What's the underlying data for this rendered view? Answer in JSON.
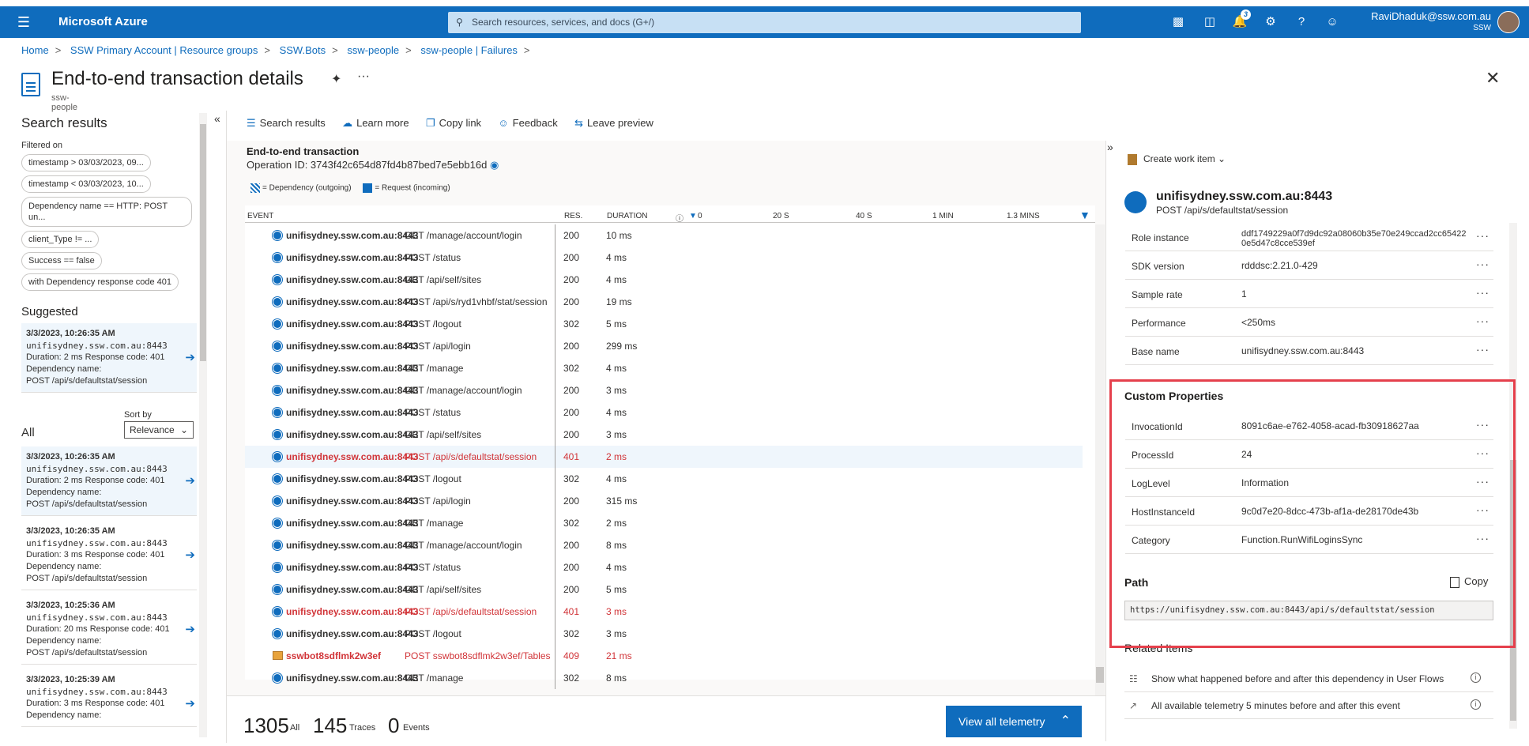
{
  "app": {
    "brand": "Microsoft Azure",
    "search_placeholder": "Search resources, services, and docs (G+/)",
    "notif_count": "3",
    "user": "RaviDhaduk@ssw.com.au",
    "org": "SSW"
  },
  "breadcrumb": [
    "Home",
    "SSW Primary Account | Resource groups",
    "SSW.Bots",
    "ssw-people",
    "ssw-people | Failures"
  ],
  "page": {
    "title": "End-to-end transaction details",
    "subtitle": "ssw-people"
  },
  "toolbar": {
    "search_results": "Search results",
    "learn_more": "Learn more",
    "copy_link": "Copy link",
    "feedback": "Feedback",
    "leave_preview": "Leave preview"
  },
  "left": {
    "title": "Search results",
    "filtered_on": "Filtered on",
    "chips": [
      "timestamp > 03/03/2023, 09...",
      "timestamp < 03/03/2023, 10...",
      "Dependency name == HTTP: POST un...",
      "client_Type != ...",
      "Success == false",
      "with Dependency response code 401"
    ],
    "suggested": "Suggested",
    "all": "All",
    "sort_by": "Sort by",
    "sort_value": "Relevance",
    "suggested_items": [
      {
        "time": "3/3/2023, 10:26:35 AM",
        "host": "unifisydney.ssw.com.au:8443",
        "meta": "Duration: 2 ms  Response code: 401",
        "dep_label": "Dependency name:",
        "dep": "POST /api/s/defaultstat/session"
      }
    ],
    "all_items": [
      {
        "time": "3/3/2023, 10:26:35 AM",
        "host": "unifisydney.ssw.com.au:8443",
        "meta": "Duration: 2 ms  Response code: 401",
        "dep_label": "Dependency name:",
        "dep": "POST /api/s/defaultstat/session"
      },
      {
        "time": "3/3/2023, 10:26:35 AM",
        "host": "unifisydney.ssw.com.au:8443",
        "meta": "Duration: 3 ms  Response code: 401",
        "dep_label": "Dependency name:",
        "dep": "POST /api/s/defaultstat/session"
      },
      {
        "time": "3/3/2023, 10:25:36 AM",
        "host": "unifisydney.ssw.com.au:8443",
        "meta": "Duration: 20 ms  Response code: 401",
        "dep_label": "Dependency name:",
        "dep": "POST /api/s/defaultstat/session"
      },
      {
        "time": "3/3/2023, 10:25:39 AM",
        "host": "unifisydney.ssw.com.au:8443",
        "meta": "Duration: 3 ms  Response code: 401",
        "dep_label": "Dependency name:",
        "dep": ""
      }
    ]
  },
  "transaction": {
    "title": "End-to-end transaction",
    "op_id": "Operation ID: 3743f42c654d87fd4b87bed7e5ebb16d",
    "legend_dep": "= Dependency (outgoing)",
    "legend_req": "= Request (incoming)",
    "headers": {
      "event": "EVENT",
      "res": "RES.",
      "duration": "DURATION"
    },
    "timeline": [
      "0",
      "20 S",
      "40 S",
      "1 MIN",
      "1.3 MINS"
    ],
    "rows": [
      {
        "host": "unifisydney.ssw.com.au:8443",
        "op": "GET /manage/account/login",
        "code": "200",
        "dur": "10 ms",
        "err": false,
        "icon": "globe"
      },
      {
        "host": "unifisydney.ssw.com.au:8443",
        "op": "POST /status",
        "code": "200",
        "dur": "4 ms",
        "err": false,
        "icon": "globe"
      },
      {
        "host": "unifisydney.ssw.com.au:8443",
        "op": "GET /api/self/sites",
        "code": "200",
        "dur": "4 ms",
        "err": false,
        "icon": "globe"
      },
      {
        "host": "unifisydney.ssw.com.au:8443",
        "op": "POST /api/s/ryd1vhbf/stat/session",
        "code": "200",
        "dur": "19 ms",
        "err": false,
        "icon": "globe"
      },
      {
        "host": "unifisydney.ssw.com.au:8443",
        "op": "POST /logout",
        "code": "302",
        "dur": "5 ms",
        "err": false,
        "icon": "globe"
      },
      {
        "host": "unifisydney.ssw.com.au:8443",
        "op": "POST /api/login",
        "code": "200",
        "dur": "299 ms",
        "err": false,
        "icon": "globe"
      },
      {
        "host": "unifisydney.ssw.com.au:8443",
        "op": "GET /manage",
        "code": "302",
        "dur": "4 ms",
        "err": false,
        "icon": "globe"
      },
      {
        "host": "unifisydney.ssw.com.au:8443",
        "op": "GET /manage/account/login",
        "code": "200",
        "dur": "3 ms",
        "err": false,
        "icon": "globe"
      },
      {
        "host": "unifisydney.ssw.com.au:8443",
        "op": "POST /status",
        "code": "200",
        "dur": "4 ms",
        "err": false,
        "icon": "globe"
      },
      {
        "host": "unifisydney.ssw.com.au:8443",
        "op": "GET /api/self/sites",
        "code": "200",
        "dur": "3 ms",
        "err": false,
        "icon": "globe"
      },
      {
        "host": "unifisydney.ssw.com.au:8443",
        "op": "POST /api/s/defaultstat/session",
        "code": "401",
        "dur": "2 ms",
        "err": true,
        "hl": true,
        "icon": "globe"
      },
      {
        "host": "unifisydney.ssw.com.au:8443",
        "op": "POST /logout",
        "code": "302",
        "dur": "4 ms",
        "err": false,
        "icon": "globe"
      },
      {
        "host": "unifisydney.ssw.com.au:8443",
        "op": "POST /api/login",
        "code": "200",
        "dur": "315 ms",
        "err": false,
        "icon": "globe"
      },
      {
        "host": "unifisydney.ssw.com.au:8443",
        "op": "GET /manage",
        "code": "302",
        "dur": "2 ms",
        "err": false,
        "icon": "globe"
      },
      {
        "host": "unifisydney.ssw.com.au:8443",
        "op": "GET /manage/account/login",
        "code": "200",
        "dur": "8 ms",
        "err": false,
        "icon": "globe"
      },
      {
        "host": "unifisydney.ssw.com.au:8443",
        "op": "POST /status",
        "code": "200",
        "dur": "4 ms",
        "err": false,
        "icon": "globe"
      },
      {
        "host": "unifisydney.ssw.com.au:8443",
        "op": "GET /api/self/sites",
        "code": "200",
        "dur": "5 ms",
        "err": false,
        "icon": "globe"
      },
      {
        "host": "unifisydney.ssw.com.au:8443",
        "op": "POST /api/s/defaultstat/session",
        "code": "401",
        "dur": "3 ms",
        "err": true,
        "icon": "globe"
      },
      {
        "host": "unifisydney.ssw.com.au:8443",
        "op": "POST /logout",
        "code": "302",
        "dur": "3 ms",
        "err": false,
        "icon": "globe"
      },
      {
        "host": "sswbot8sdflmk2w3ef",
        "op": "POST sswbot8sdflmk2w3ef/Tables",
        "code": "409",
        "dur": "21 ms",
        "err": true,
        "icon": "table"
      },
      {
        "host": "unifisydney.ssw.com.au:8443",
        "op": "GET /manage",
        "code": "302",
        "dur": "8 ms",
        "err": false,
        "icon": "globe"
      }
    ],
    "footer": {
      "all_count": "1305",
      "all_label": "All",
      "traces_count": "145",
      "traces_label": "Traces",
      "events_count": "0",
      "events_label": "Events",
      "view_all": "View all telemetry"
    }
  },
  "details": {
    "create_work_item": "Create work item",
    "host": "unifisydney.ssw.com.au:8443",
    "op": "POST /api/s/defaultstat/session",
    "props": [
      {
        "k": "Role instance",
        "v": "ddf1749229a0f7d9dc92a08060b35e70e249ccad2cc654220e5d47c8cce539ef"
      },
      {
        "k": "SDK version",
        "v": "rdddsc:2.21.0-429"
      },
      {
        "k": "Sample rate",
        "v": "1"
      },
      {
        "k": "Performance",
        "v": "<250ms"
      },
      {
        "k": "Base name",
        "v": "unifisydney.ssw.com.au:8443"
      }
    ],
    "custom_title": "Custom Properties",
    "custom": [
      {
        "k": "InvocationId",
        "v": "8091c6ae-e762-4058-acad-fb30918627aa"
      },
      {
        "k": "ProcessId",
        "v": "24"
      },
      {
        "k": "LogLevel",
        "v": "Information"
      },
      {
        "k": "HostInstanceId",
        "v": "9c0d7e20-8dcc-473b-af1a-de28170de43b"
      },
      {
        "k": "Category",
        "v": "Function.RunWifiLoginsSync"
      }
    ],
    "path_title": "Path",
    "copy": "Copy",
    "path": "https://unifisydney.ssw.com.au:8443/api/s/defaultstat/session",
    "related_title": "Related Items",
    "related": [
      {
        "t": "Show what happened before and after this dependency in User Flows"
      },
      {
        "t": "All available telemetry 5 minutes before and after this event"
      }
    ]
  }
}
